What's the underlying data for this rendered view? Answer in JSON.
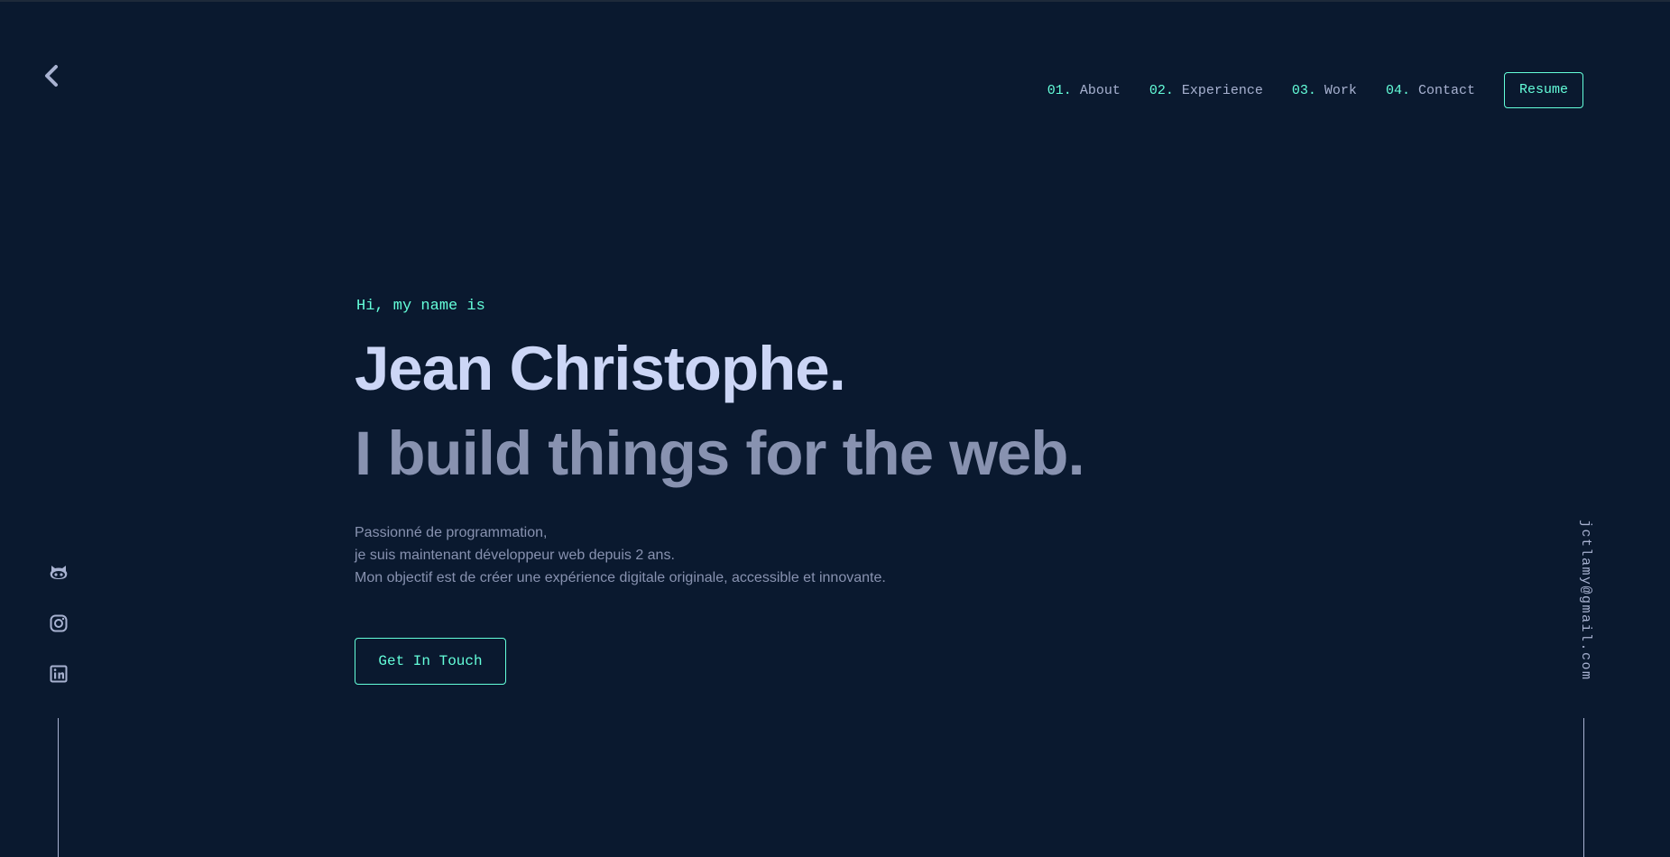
{
  "nav": {
    "items": [
      {
        "num": "01.",
        "label": "About"
      },
      {
        "num": "02.",
        "label": "Experience"
      },
      {
        "num": "03.",
        "label": "Work"
      },
      {
        "num": "04.",
        "label": "Contact"
      }
    ],
    "resume_label": "Resume"
  },
  "hero": {
    "intro": "Hi, my name is",
    "name": "Jean Christophe.",
    "tagline": "I build things for the web.",
    "bio": [
      "Passionné de programmation,",
      "je suis maintenant développeur web depuis 2 ans.",
      "Mon objectif est de créer une expérience digitale originale, accessible et innovante."
    ],
    "cta_label": "Get In Touch"
  },
  "social": {
    "icons": [
      "github-icon",
      "instagram-icon",
      "linkedin-icon"
    ]
  },
  "email": "jctlamy@gmail.com",
  "colors": {
    "background": "#0a192f",
    "accent": "#64ffda",
    "heading": "#ccd6f6",
    "text": "#8892b0",
    "light_text": "#a8b2d1"
  },
  "icons": {
    "logo": "chevron-left-icon"
  }
}
